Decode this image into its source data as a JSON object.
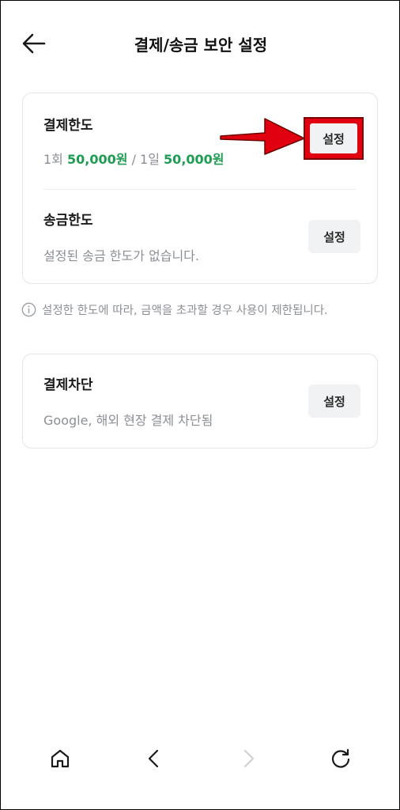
{
  "header": {
    "title": "결제/송금 보안 설정"
  },
  "payment_limit": {
    "title": "결제한도",
    "once_label": "1회",
    "once_value": "50,000원",
    "separator": "/",
    "day_label": "1일",
    "day_value": "50,000원",
    "button_label": "설정"
  },
  "transfer_limit": {
    "title": "송금한도",
    "description": "설정된 송금 한도가 없습니다.",
    "button_label": "설정"
  },
  "info": {
    "text": "설정한 한도에 따라, 금액을 초과할 경우 사용이 제한됩니다."
  },
  "payment_block": {
    "title": "결제차단",
    "description": "Google, 해외 현장 결제 차단됨",
    "button_label": "설정"
  },
  "bottom_nav": {
    "icons": [
      "home-icon",
      "chevron-left-icon",
      "chevron-right-icon",
      "refresh-icon"
    ]
  },
  "colors": {
    "accent_green": "#1e9c52",
    "highlight_red": "#e00010",
    "muted_text": "#8b8f96",
    "button_bg": "#f1f2f4"
  }
}
